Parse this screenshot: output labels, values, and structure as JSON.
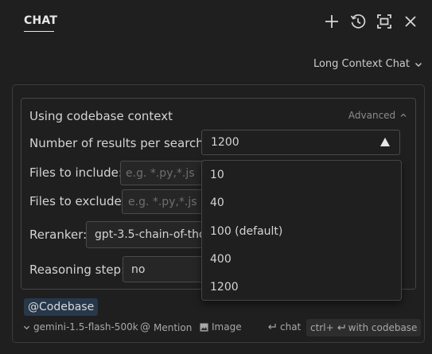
{
  "header": {
    "tab_label": "CHAT",
    "icons": [
      "plus-icon",
      "history-icon",
      "maximize-icon",
      "close-icon"
    ]
  },
  "mode_selector": {
    "label": "Long Context Chat",
    "icon": "chevron-down-icon"
  },
  "context": {
    "title": "Using codebase context",
    "advanced_label": "Advanced",
    "results_per_search": {
      "label": "Number of results per search:",
      "value": "1200",
      "options": [
        "10",
        "40",
        "100 (default)",
        "400",
        "1200"
      ]
    },
    "files_include": {
      "label": "Files to include:",
      "placeholder": "e.g. *.py,*.js"
    },
    "files_exclude": {
      "label": "Files to exclude:",
      "placeholder": "e.g. *.py,*.js"
    },
    "reranker": {
      "label": "Reranker:",
      "value": "gpt-3.5-chain-of-thou"
    },
    "reasoning": {
      "label": "Reasoning step:",
      "value": "no"
    }
  },
  "mention_chip": "@Codebase",
  "toolbar": {
    "model": "gemini-1.5-flash-500k",
    "mention": "Mention",
    "image": "Image",
    "chat": "chat",
    "codebase_shortcut": "ctrl+",
    "codebase_label": "with codebase"
  },
  "colors": {
    "background": "#1f1f1f",
    "chip_background": "#27384b",
    "border": "#454545"
  }
}
